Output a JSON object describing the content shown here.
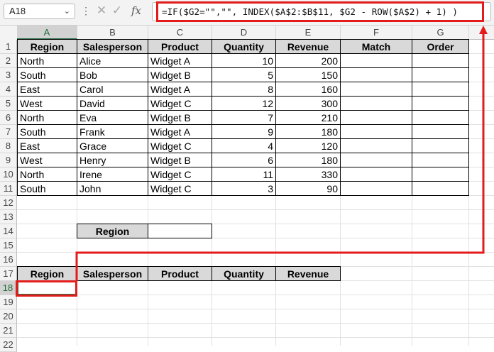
{
  "name_box": {
    "value": "A18"
  },
  "formula_bar": {
    "formula": "=IF($G2=\"\",\"\", INDEX($A$2:$B$11, $G2 - ROW($A$2) + 1) )",
    "fx_label": "fx"
  },
  "columns": [
    "A",
    "B",
    "C",
    "D",
    "E",
    "F",
    "G"
  ],
  "rows": [
    "1",
    "2",
    "3",
    "4",
    "5",
    "6",
    "7",
    "8",
    "9",
    "10",
    "11",
    "12",
    "13",
    "14",
    "15",
    "16",
    "17",
    "18",
    "19",
    "20",
    "21",
    "22"
  ],
  "table": {
    "headers": [
      "Region",
      "Salesperson",
      "Product",
      "Quantity",
      "Revenue",
      "Match",
      "Order"
    ],
    "rows": [
      [
        "North",
        "Alice",
        "Widget A",
        "10",
        "200"
      ],
      [
        "South",
        "Bob",
        "Widget B",
        "5",
        "150"
      ],
      [
        "East",
        "Carol",
        "Widget A",
        "8",
        "160"
      ],
      [
        "West",
        "David",
        "Widget C",
        "12",
        "300"
      ],
      [
        "North",
        "Eva",
        "Widget B",
        "7",
        "210"
      ],
      [
        "South",
        "Frank",
        "Widget A",
        "9",
        "180"
      ],
      [
        "East",
        "Grace",
        "Widget C",
        "4",
        "120"
      ],
      [
        "West",
        "Henry",
        "Widget B",
        "6",
        "180"
      ],
      [
        "North",
        "Irene",
        "Widget C",
        "11",
        "330"
      ],
      [
        "South",
        "John",
        "Widget C",
        "3",
        "90"
      ]
    ]
  },
  "criteria": {
    "label": "Region",
    "value": ""
  },
  "results": {
    "headers": [
      "Region",
      "Salesperson",
      "Product",
      "Quantity",
      "Revenue"
    ]
  },
  "colors": {
    "highlight": "#e31b1b",
    "header_fill": "#d9d9d9",
    "selection": "#217346"
  }
}
